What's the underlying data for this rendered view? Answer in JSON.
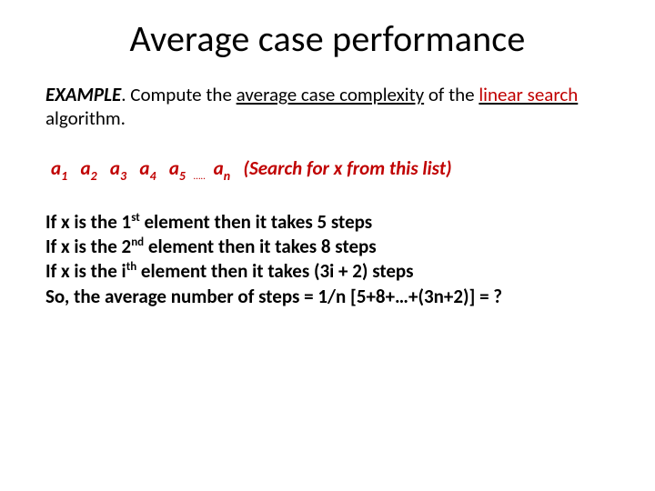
{
  "title": "Average case performance",
  "intro": {
    "example_label": "EXAMPLE",
    "before": ". Compute the ",
    "avg": "average case complexity",
    "mid": " of the ",
    "linsearch": "linear search",
    "after": " algorithm."
  },
  "listline": {
    "a": "a",
    "s1": "1",
    "s2": "2",
    "s3": "3",
    "s4": "4",
    "s5": "5",
    "dots": "…..",
    "sn": "n",
    "paren": "(Search for x from this list)"
  },
  "steps": {
    "l1a": "If x is the 1",
    "l1s": "st",
    "l1b": " element then it takes 5 steps",
    "l2a": "If x is the 2",
    "l2s": "nd",
    "l2b": " element then it takes 8 steps",
    "l3a": "If x is the i",
    "l3s": "th",
    "l3b": " element then it takes (3i + 2) steps",
    "l4": "So, the average number of steps = 1/n [5+8+…+(3n+2)] = ?"
  }
}
